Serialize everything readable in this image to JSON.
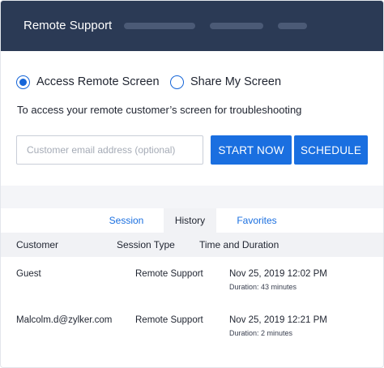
{
  "header": {
    "title": "Remote Support"
  },
  "mode": {
    "options": [
      {
        "label": "Access Remote Screen",
        "selected": true
      },
      {
        "label": "Share My Screen",
        "selected": false
      }
    ],
    "description": "To access your remote customer’s screen for troubleshooting"
  },
  "email": {
    "placeholder": "Customer email address (optional)",
    "value": ""
  },
  "actions": {
    "start_label": "START NOW",
    "schedule_label": "SCHEDULE"
  },
  "tabs": [
    {
      "label": "Session",
      "active": false
    },
    {
      "label": "History",
      "active": true
    },
    {
      "label": "Favorites",
      "active": false
    }
  ],
  "table": {
    "headers": [
      "Customer",
      "Session Type",
      "Time and Duration"
    ],
    "rows": [
      {
        "customer": "Guest",
        "session_type": "Remote Support",
        "time": "Nov 25, 2019 12:02 PM",
        "duration": "Duration: 43 minutes"
      },
      {
        "customer": "Malcolm.d@zylker.com",
        "session_type": "Remote Support",
        "time": "Nov 25, 2019 12:21 PM",
        "duration": "Duration: 2 minutes"
      }
    ]
  },
  "colors": {
    "header_bg": "#2b3a55",
    "accent": "#1a6fe0",
    "band_bg": "#f4f5f8"
  }
}
